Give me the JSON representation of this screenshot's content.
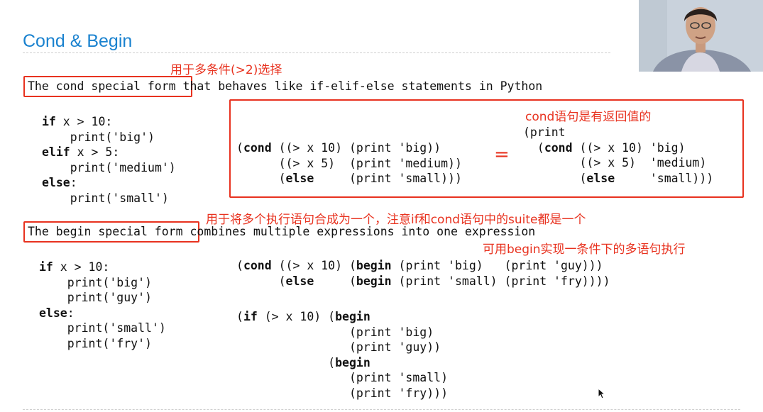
{
  "slide": {
    "title": "Cond & Begin",
    "notes": {
      "cond_multi": "用于多条件(>2)选择",
      "cond_returns": "cond语句是有返回值的",
      "begin_combine": "用于将多个执行语句合成为一个，注意if和cond语句中的suite都是一个",
      "begin_use": "可用begin实现一条件下的多语句执行"
    },
    "cond_section": {
      "term": "The cond special form",
      "rest": " that behaves like if-elif-else statements in Python",
      "python_code": [
        [
          {
            "k": "if"
          },
          {
            "t": " x > 10:"
          }
        ],
        [
          {
            "t": "    print('big')"
          }
        ],
        [
          {
            "k": "elif"
          },
          {
            "t": " x > 5:"
          }
        ],
        [
          {
            "t": "    print('medium')"
          }
        ],
        [
          {
            "k": "else"
          },
          {
            "t": ":"
          }
        ],
        [
          {
            "t": "    print('small')"
          }
        ]
      ],
      "scheme_left": [
        [
          {
            "t": "("
          },
          {
            "k": "cond"
          },
          {
            "t": " ((> x 10) (print 'big))"
          }
        ],
        [
          {
            "t": "      ((> x 5)  (print 'medium))"
          }
        ],
        [
          {
            "t": "      ("
          },
          {
            "k": "else"
          },
          {
            "t": "     (print 'small)))"
          }
        ]
      ],
      "equals": "=",
      "scheme_right": [
        [
          {
            "t": "(print"
          }
        ],
        [
          {
            "t": "  ("
          },
          {
            "k": "cond"
          },
          {
            "t": " ((> x 10) 'big)"
          }
        ],
        [
          {
            "t": "        ((> x 5)  'medium)"
          }
        ],
        [
          {
            "t": "        ("
          },
          {
            "k": "else"
          },
          {
            "t": "     'small)))"
          }
        ]
      ]
    },
    "begin_section": {
      "term": "The begin special form",
      "rest": " combines multiple expressions into one expression",
      "python_code": [
        [
          {
            "k": "if"
          },
          {
            "t": " x > 10:"
          }
        ],
        [
          {
            "t": "    print('big')"
          }
        ],
        [
          {
            "t": "    print('guy')"
          }
        ],
        [
          {
            "k": "else"
          },
          {
            "t": ":"
          }
        ],
        [
          {
            "t": "    print('small')"
          }
        ],
        [
          {
            "t": "    print('fry')"
          }
        ]
      ],
      "scheme_cond": [
        [
          {
            "t": "("
          },
          {
            "k": "cond"
          },
          {
            "t": " ((> x 10) ("
          },
          {
            "k": "begin"
          },
          {
            "t": " (print 'big)   (print 'guy)))"
          }
        ],
        [
          {
            "t": "      ("
          },
          {
            "k": "else"
          },
          {
            "t": "     ("
          },
          {
            "k": "begin"
          },
          {
            "t": " (print 'small) (print 'fry))))"
          }
        ]
      ],
      "scheme_if": [
        [
          {
            "t": "("
          },
          {
            "k": "if"
          },
          {
            "t": " (> x 10) ("
          },
          {
            "k": "begin"
          }
        ],
        [
          {
            "t": "                (print 'big)"
          }
        ],
        [
          {
            "t": "                (print 'guy))"
          }
        ],
        [
          {
            "t": "             ("
          },
          {
            "k": "begin"
          }
        ],
        [
          {
            "t": "                (print 'small)"
          }
        ],
        [
          {
            "t": "                (print 'fry)))"
          }
        ]
      ]
    }
  },
  "colors": {
    "accent_red": "#e8321f",
    "title_blue": "#1a82cf"
  },
  "icons": {
    "cursor": "mouse-pointer-icon",
    "video": "presenter-webcam"
  }
}
